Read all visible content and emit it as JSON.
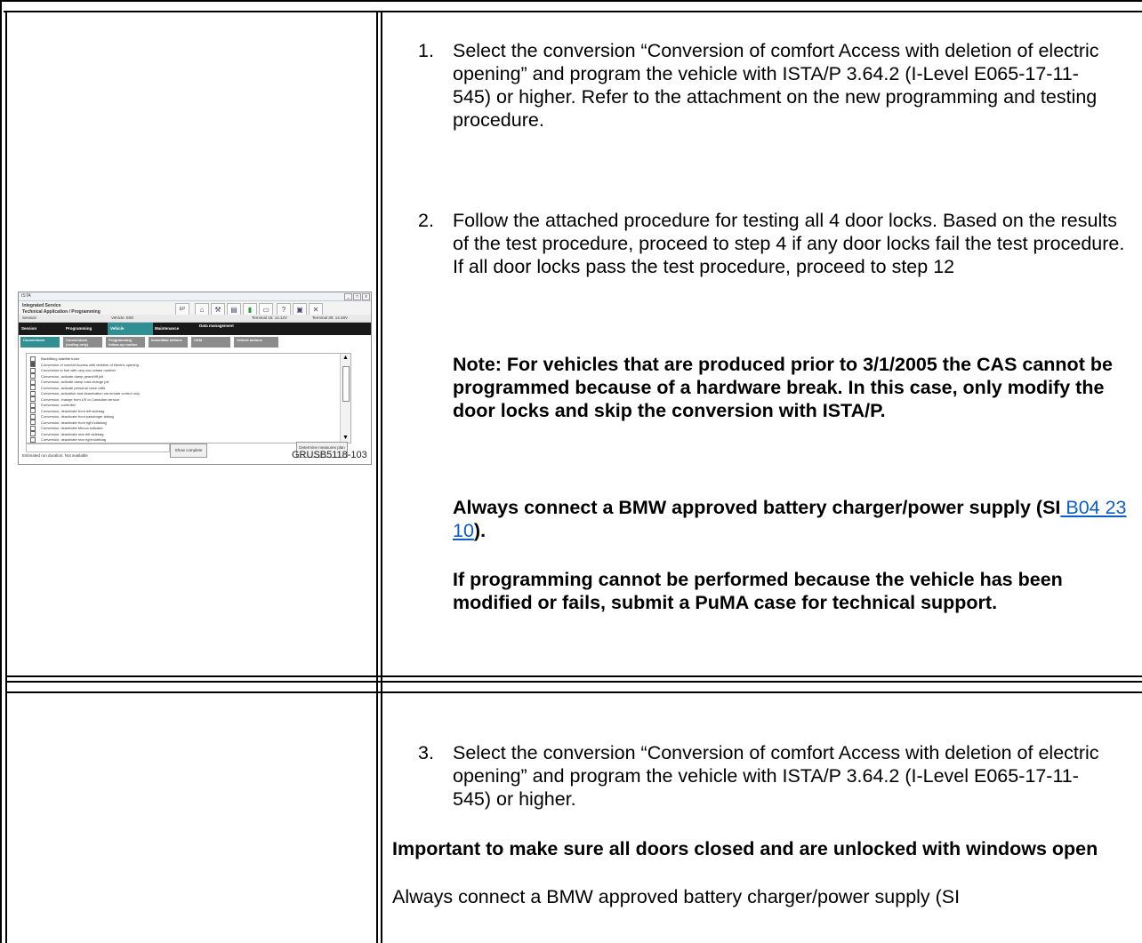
{
  "row1": {
    "image": {
      "window_title": "ISTA",
      "app_title_1": "Integrated Service",
      "app_title_2": "Technical Application / Programming",
      "session_label": "Session",
      "vehicle_label": "Vehicle: E90",
      "terminal_15": "Terminal 15:  14.12V",
      "terminal_30": "Terminal 30:  14.48V",
      "nav_tabs": [
        "Session",
        "Programming",
        "Vehicle",
        "Maintenance",
        "Data management"
      ],
      "sub_tabs": [
        "Conversions",
        "Conversions (coding only)",
        "Programming follow-up routine",
        "Immediate actions",
        "CKM",
        "Vehicle actions"
      ],
      "list_items": [
        {
          "label": "Backfitting satellite tuner",
          "checked": false
        },
        {
          "label": "Conversion of comfort Access with deletion of electric opening",
          "checked": true
        },
        {
          "label": "Conversion to fuel with very low octane number",
          "checked": false
        },
        {
          "label": "Conversion, activate damp gearshift jolt",
          "checked": false
        },
        {
          "label": "Conversion, activate damp load change jolt",
          "checked": false
        },
        {
          "label": "Conversion, activate personal voice calls",
          "checked": false
        },
        {
          "label": "Conversion, activation and deactivation via remote control only",
          "checked": false
        },
        {
          "label": "Conversion, change from US to Canadian version",
          "checked": false
        },
        {
          "label": "Conversion, controller",
          "checked": false
        },
        {
          "label": "Conversion, deactivate front left sidebag",
          "checked": false
        },
        {
          "label": "Conversion, deactivate front passenger airbag",
          "checked": false
        },
        {
          "label": "Conversion, deactivate front right sidebag",
          "checked": false
        },
        {
          "label": "Conversion, deactivate Mecca indicator",
          "checked": false
        },
        {
          "label": "Conversion, deactivate rear left sidebag",
          "checked": false
        },
        {
          "label": "Conversion, deactivate rear right sidebag",
          "checked": false
        }
      ],
      "run_duration": "Estimated run duration:  Not available",
      "show_complete": "Show complete",
      "determine_plan": "Determine measures plan",
      "caption": "GRUSB5118-103"
    },
    "step1": {
      "num": "1.",
      "text": "Select the conversion “Conversion of comfort Access with deletion of electric opening” and program the vehicle with ISTA/P 3.64.2 (I-Level E065-17-11-545) or higher. Refer to the attachment on the new programming and testing procedure."
    },
    "step2": {
      "num": "2.",
      "text": "Follow the attached procedure for testing all 4 door locks. Based on the results of the test procedure, proceed to step 4 if any door locks fail the test procedure. If all door locks pass the test procedure, proceed to step 12"
    },
    "note": "Note: For vehicles that are produced prior to 3/1/2005 the CAS cannot be programmed because of a hardware break. In this case, only modify the door locks and skip the conversion with ISTA/P.",
    "charger_prefix": "Always connect a BMW approved battery charger/power supply (SI",
    "charger_link": " B04 23 10",
    "charger_suffix": ").",
    "puma": "If programming cannot be performed because the vehicle has been modified or fails, submit a PuMA case for technical support."
  },
  "row2": {
    "step3": {
      "num": "3.",
      "text": "Select the conversion “Conversion of comfort Access with deletion of electric opening” and program the vehicle with ISTA/P 3.64.2 (I-Level E065-17-11-545) or higher."
    },
    "important": "Important to make sure all doors closed and are unlocked with windows open",
    "charger": "Always connect a BMW approved battery charger/power supply (SI"
  }
}
